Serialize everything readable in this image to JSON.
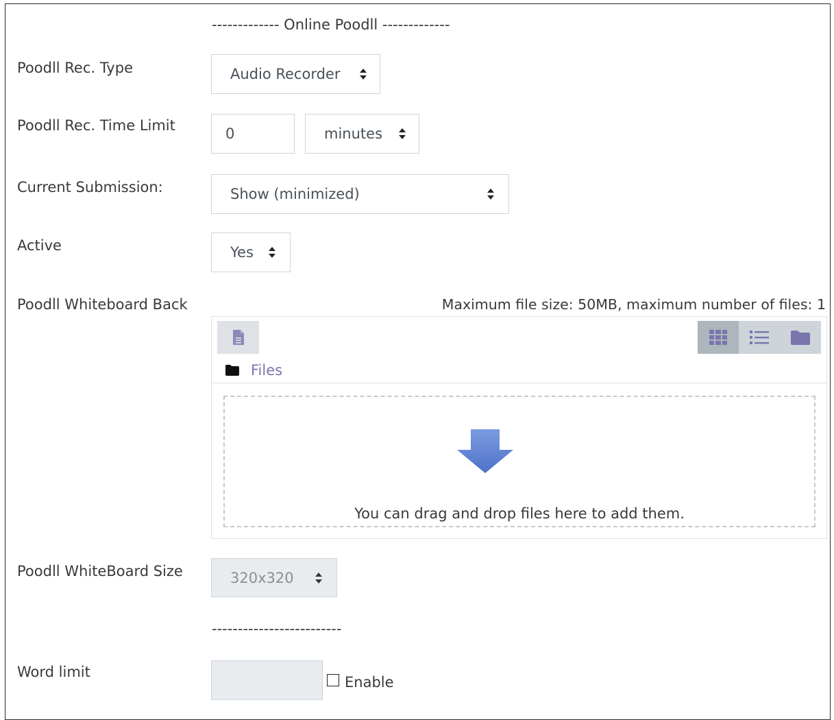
{
  "section": {
    "header": "------------- Online Poodll -------------",
    "footer": "-------------------------"
  },
  "fields": {
    "rec_type": {
      "label": "Poodll Rec. Type",
      "value": "Audio Recorder"
    },
    "time_limit": {
      "label": "Poodll Rec. Time Limit",
      "value": "0",
      "unit": "minutes"
    },
    "current_submission": {
      "label": "Current Submission:",
      "value": "Show (minimized)"
    },
    "active": {
      "label": "Active",
      "value": "Yes"
    },
    "whiteboard_back": {
      "label": "Poodll Whiteboard Back",
      "limits": "Maximum file size: 50MB, maximum number of files: 1",
      "path_label": "Files",
      "drop_text": "You can drag and drop files here to add them."
    },
    "whiteboard_size": {
      "label": "Poodll WhiteBoard Size",
      "value": "320x320"
    },
    "word_limit": {
      "label": "Word limit",
      "value": "",
      "enable_label": "Enable",
      "enabled": false
    }
  },
  "icons": {
    "add_file": "file-icon",
    "view_icons": "grid-icon",
    "view_details": "list-icon",
    "view_tree": "folder-icon",
    "path": "folder-icon",
    "drop": "arrow-down-icon"
  },
  "colors": {
    "accent": "#5a7fcf",
    "link": "#7a75ad",
    "icon": "#8d88b8"
  }
}
